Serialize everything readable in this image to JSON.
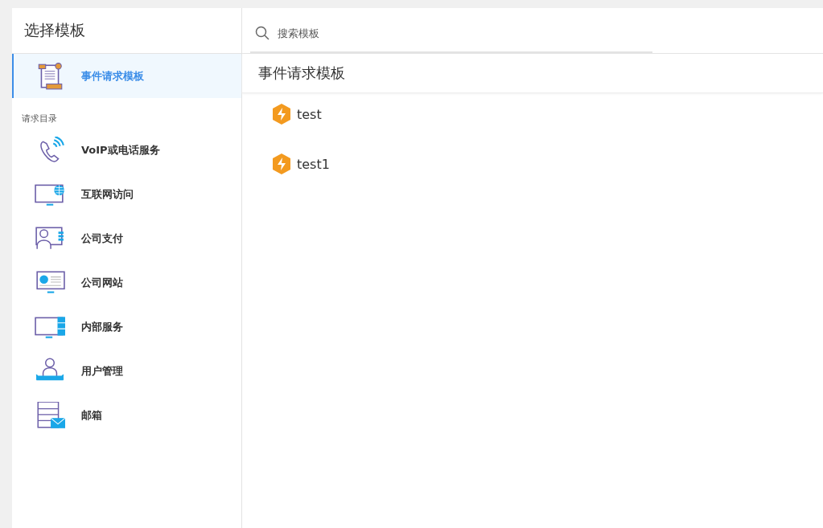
{
  "sidebar": {
    "title": "选择模板",
    "items": [
      {
        "label": "事件请求模板",
        "kind": "scroll",
        "selected": true
      }
    ],
    "catalog": {
      "title": "请求目录",
      "items": [
        {
          "label": "VoIP或电话服务",
          "kind": "phone",
          "selected": false
        },
        {
          "label": "互联网访问",
          "kind": "globe",
          "selected": false
        },
        {
          "label": "公司支付",
          "kind": "card",
          "selected": false
        },
        {
          "label": "公司网站",
          "kind": "website",
          "selected": false
        },
        {
          "label": "内部服务",
          "kind": "server",
          "selected": false
        },
        {
          "label": "用户管理",
          "kind": "user",
          "selected": false
        },
        {
          "label": "邮箱",
          "kind": "mail",
          "selected": false
        }
      ]
    }
  },
  "search": {
    "placeholder": "搜索模板"
  },
  "content": {
    "title": "事件请求模板",
    "templates": [
      {
        "label": "test"
      },
      {
        "label": "test1"
      }
    ]
  }
}
